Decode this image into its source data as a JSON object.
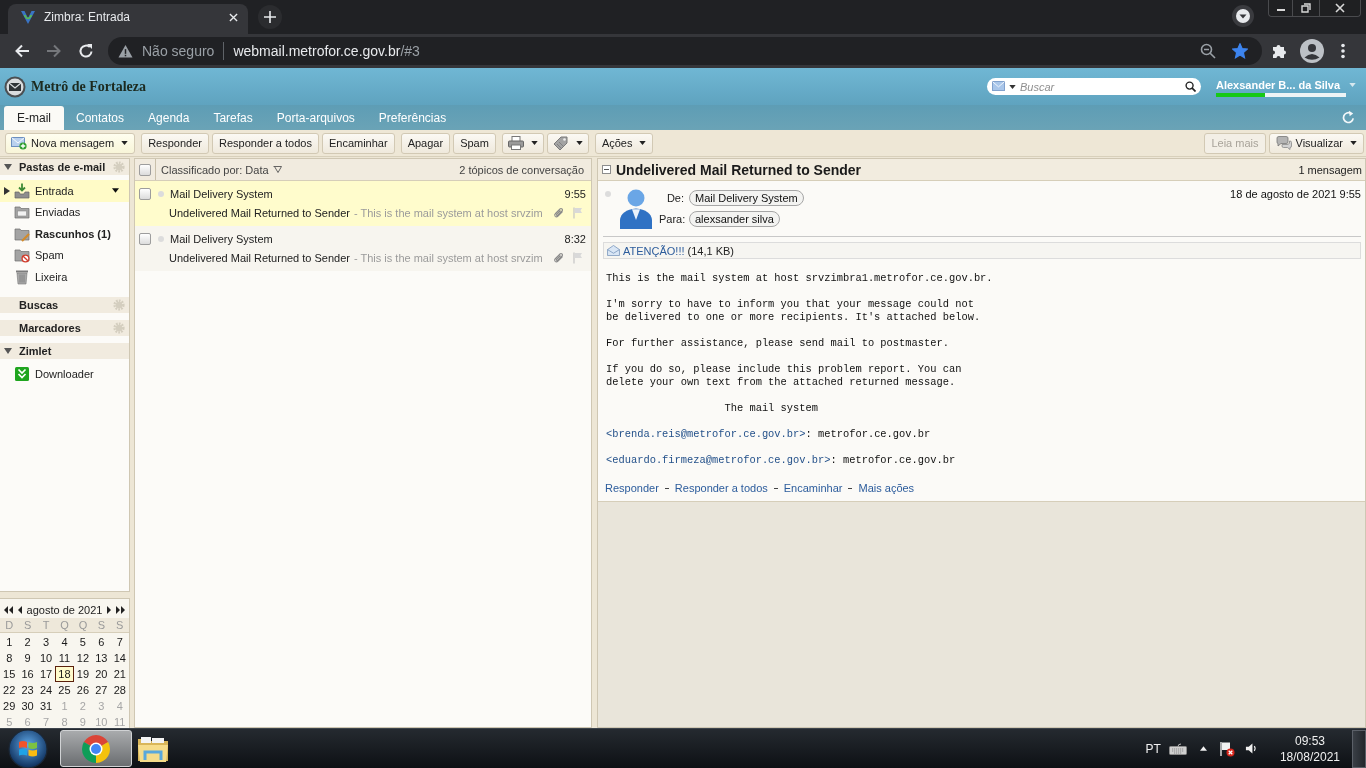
{
  "browser": {
    "tabs": [
      {
        "title": "Zimbra: Entrada",
        "selected": true
      }
    ],
    "forward": {
      "disabled": true
    },
    "address": {
      "security": "Não seguro",
      "host": "webmail.metrofor.ce.gov.br",
      "path": "/#3"
    },
    "bookmarked": true
  },
  "header": {
    "logo": "Metrô de Fortaleza",
    "search_placeholder": "Buscar",
    "user": "Alexsander B... da Silva",
    "quota": {
      "level": 0.38
    }
  },
  "tabs": [
    {
      "label": "E-mail",
      "selected": true
    },
    {
      "label": "Contatos",
      "selected": false
    },
    {
      "label": "Agenda",
      "selected": false
    },
    {
      "label": "Tarefas",
      "selected": false
    },
    {
      "label": "Porta-arquivos",
      "selected": false
    },
    {
      "label": "Preferências",
      "selected": false
    }
  ],
  "toolbar": {
    "new_message": "Nova mensagem",
    "reply_group": [
      "Responder",
      "Responder a todos",
      "Encaminhar"
    ],
    "delete_group": [
      "Apagar",
      "Spam"
    ],
    "actions": "Ações",
    "read_more": {
      "label": "Leia mais",
      "disabled": true
    },
    "view": "Visualizar"
  },
  "sidebar": {
    "sections": [
      {
        "kind": "folders",
        "title": "Pastas de e-mail",
        "expanded": true,
        "items": [
          {
            "kind": "inbox",
            "label": "Entrada",
            "selected": true,
            "unread": false
          },
          {
            "kind": "sent",
            "label": "Enviadas",
            "selected": false,
            "unread": false
          },
          {
            "kind": "drafts",
            "label": "Rascunhos (1)",
            "selected": false,
            "unread": true
          },
          {
            "kind": "spam",
            "label": "Spam",
            "selected": false,
            "unread": false
          },
          {
            "kind": "trash",
            "label": "Lixeira",
            "selected": false,
            "unread": false
          }
        ]
      },
      {
        "kind": "searches",
        "title": "Buscas"
      },
      {
        "kind": "tags",
        "title": "Marcadores"
      },
      {
        "kind": "zimlets",
        "title": "Zimlet",
        "expanded": true,
        "items": [
          {
            "kind": "zimlet",
            "label": "Downloader",
            "selected": false,
            "unread": false
          }
        ]
      }
    ]
  },
  "calendar": {
    "title": "agosto de 2021",
    "weekdays": [
      "D",
      "S",
      "T",
      "Q",
      "Q",
      "S",
      "S"
    ],
    "weeks": [
      [
        {
          "day": "1",
          "other_month": false,
          "selected": false
        },
        {
          "day": "2",
          "other_month": false,
          "selected": false
        },
        {
          "day": "3",
          "other_month": false,
          "selected": false
        },
        {
          "day": "4",
          "other_month": false,
          "selected": false
        },
        {
          "day": "5",
          "other_month": false,
          "selected": false
        },
        {
          "day": "6",
          "other_month": false,
          "selected": false
        },
        {
          "day": "7",
          "other_month": false,
          "selected": false
        }
      ],
      [
        {
          "day": "8",
          "other_month": false,
          "selected": false
        },
        {
          "day": "9",
          "other_month": false,
          "selected": false
        },
        {
          "day": "10",
          "other_month": false,
          "selected": false
        },
        {
          "day": "11",
          "other_month": false,
          "selected": false
        },
        {
          "day": "12",
          "other_month": false,
          "selected": false
        },
        {
          "day": "13",
          "other_month": false,
          "selected": false
        },
        {
          "day": "14",
          "other_month": false,
          "selected": false
        }
      ],
      [
        {
          "day": "15",
          "other_month": false,
          "selected": false
        },
        {
          "day": "16",
          "other_month": false,
          "selected": false
        },
        {
          "day": "17",
          "other_month": false,
          "selected": false
        },
        {
          "day": "18",
          "other_month": false,
          "selected": true
        },
        {
          "day": "19",
          "other_month": false,
          "selected": false
        },
        {
          "day": "20",
          "other_month": false,
          "selected": false
        },
        {
          "day": "21",
          "other_month": false,
          "selected": false
        }
      ],
      [
        {
          "day": "22",
          "other_month": false,
          "selected": false
        },
        {
          "day": "23",
          "other_month": false,
          "selected": false
        },
        {
          "day": "24",
          "other_month": false,
          "selected": false
        },
        {
          "day": "25",
          "other_month": false,
          "selected": false
        },
        {
          "day": "26",
          "other_month": false,
          "selected": false
        },
        {
          "day": "27",
          "other_month": false,
          "selected": false
        },
        {
          "day": "28",
          "other_month": false,
          "selected": false
        }
      ],
      [
        {
          "day": "29",
          "other_month": false,
          "selected": false
        },
        {
          "day": "30",
          "other_month": false,
          "selected": false
        },
        {
          "day": "31",
          "other_month": false,
          "selected": false
        },
        {
          "day": "1",
          "other_month": true,
          "selected": false
        },
        {
          "day": "2",
          "other_month": true,
          "selected": false
        },
        {
          "day": "3",
          "other_month": true,
          "selected": false
        },
        {
          "day": "4",
          "other_month": true,
          "selected": false
        }
      ],
      [
        {
          "day": "5",
          "other_month": true,
          "selected": false
        },
        {
          "day": "6",
          "other_month": true,
          "selected": false
        },
        {
          "day": "7",
          "other_month": true,
          "selected": false
        },
        {
          "day": "8",
          "other_month": true,
          "selected": false
        },
        {
          "day": "9",
          "other_month": true,
          "selected": false
        },
        {
          "day": "10",
          "other_month": true,
          "selected": false
        },
        {
          "day": "11",
          "other_month": true,
          "selected": false
        }
      ]
    ]
  },
  "message_list": {
    "select_all": {
      "checked": false
    },
    "sort": "Classificado por: Data",
    "count": "2 tópicos de conversação",
    "rows": [
      {
        "sender": "Mail Delivery System",
        "time": "9:55",
        "subject": "Undelivered Mail Returned to Sender",
        "preview": "- This is the mail system at host srvzim",
        "selected": true,
        "checked": false,
        "unread": false,
        "attachment": true,
        "flagged": false
      },
      {
        "sender": "Mail Delivery System",
        "time": "8:32",
        "subject": "Undelivered Mail Returned to Sender",
        "preview": "- This is the mail system at host srvzim",
        "selected": false,
        "checked": false,
        "unread": false,
        "attachment": true,
        "flagged": false
      }
    ]
  },
  "reading_pane": {
    "subject": "Undelivered Mail Returned to Sender",
    "count": "1 mensagem",
    "message": {
      "unread": false,
      "from_label": "De:",
      "from": "Mail Delivery System",
      "to_label": "Para:",
      "to": "alexsander silva",
      "date": "18 de agosto de 2021 9:55",
      "attachment": {
        "name": "ATENÇÃO!!!",
        "size": "(14,1 KB)"
      },
      "body": [
        {
          "kind": "text",
          "text": "This is the mail system at host srvzimbra1.metrofor.ce.gov.br."
        },
        {
          "kind": "text",
          "text": "I'm sorry to have to inform you that your message could not\nbe delivered to one or more recipients. It's attached below."
        },
        {
          "kind": "text",
          "text": "For further assistance, please send mail to postmaster."
        },
        {
          "kind": "text",
          "text": "If you do so, please include this problem report. You can\ndelete your own text from the attached returned message."
        },
        {
          "kind": "signature",
          "text": "The mail system"
        },
        {
          "kind": "recipient",
          "link": "<brenda.reis@metrofor.ce.gov.br>",
          "text": ": metrofor.ce.gov.br"
        },
        {
          "kind": "recipient",
          "link": "<eduardo.firmeza@metrofor.ce.gov.br>",
          "text": ": metrofor.ce.gov.br"
        }
      ],
      "actions": [
        "Responder",
        "Responder a todos",
        "Encaminhar",
        "Mais ações"
      ]
    }
  },
  "taskbar": {
    "apps": [
      {
        "kind": "browser",
        "selected": true
      },
      {
        "kind": "explorer",
        "selected": false
      }
    ],
    "language": "PT",
    "time": "09:53",
    "date": "18/08/2021"
  }
}
